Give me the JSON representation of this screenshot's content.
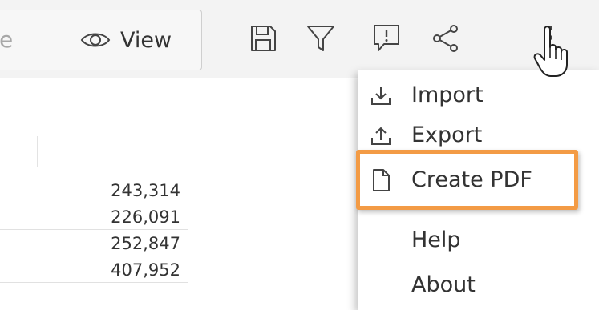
{
  "toolbar": {
    "partial_button_label": "e",
    "view_button_label": "View",
    "icons": [
      "save-icon",
      "filter-icon",
      "comment-icon",
      "share-icon",
      "more-vertical-icon"
    ]
  },
  "table": {
    "values": [
      "243,314",
      "226,091",
      "252,847",
      "407,952"
    ]
  },
  "menu": {
    "items": [
      {
        "label": "Import",
        "icon": "import-icon"
      },
      {
        "label": "Export",
        "icon": "export-icon"
      },
      {
        "label": "Create PDF",
        "icon": "pdf-file-icon"
      },
      {
        "label": "Help",
        "icon": ""
      },
      {
        "label": "About",
        "icon": ""
      }
    ],
    "highlighted_item": "Create PDF"
  },
  "colors": {
    "toolbar_bg": "#f3f3f3",
    "highlight": "#f39b45",
    "text": "#333333",
    "icon_stroke": "#444444"
  }
}
